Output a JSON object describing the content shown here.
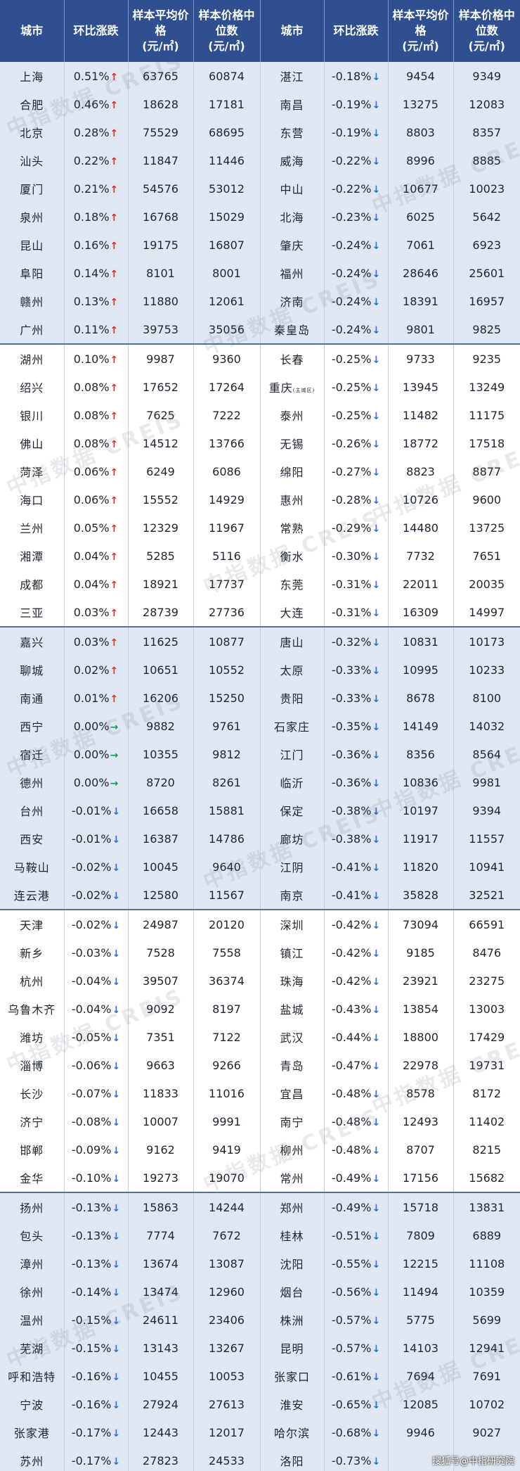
{
  "headers": [
    "城市",
    "环比涨跌",
    "样本平均价格",
    "(元/㎡)",
    "样本价格中位数",
    "(元/㎡)"
  ],
  "rows": [
    {
      "l": [
        "上海",
        "0.51%",
        "up",
        "63765",
        "60874"
      ],
      "r": [
        "湛江",
        "-0.18%",
        "down",
        "9454",
        "9349"
      ]
    },
    {
      "l": [
        "合肥",
        "0.46%",
        "up",
        "18628",
        "17181"
      ],
      "r": [
        "南昌",
        "-0.19%",
        "down",
        "13275",
        "12083"
      ]
    },
    {
      "l": [
        "北京",
        "0.28%",
        "up",
        "75529",
        "68695"
      ],
      "r": [
        "东营",
        "-0.19%",
        "down",
        "8803",
        "8357"
      ]
    },
    {
      "l": [
        "汕头",
        "0.22%",
        "up",
        "11847",
        "11446"
      ],
      "r": [
        "威海",
        "-0.22%",
        "down",
        "8996",
        "8885"
      ]
    },
    {
      "l": [
        "厦门",
        "0.21%",
        "up",
        "54576",
        "53012"
      ],
      "r": [
        "中山",
        "-0.22%",
        "down",
        "10677",
        "10023"
      ]
    },
    {
      "l": [
        "泉州",
        "0.18%",
        "up",
        "16768",
        "15029"
      ],
      "r": [
        "北海",
        "-0.23%",
        "down",
        "6025",
        "5642"
      ]
    },
    {
      "l": [
        "昆山",
        "0.16%",
        "up",
        "19175",
        "16807"
      ],
      "r": [
        "肇庆",
        "-0.24%",
        "down",
        "7061",
        "6923"
      ]
    },
    {
      "l": [
        "阜阳",
        "0.14%",
        "up",
        "8101",
        "8001"
      ],
      "r": [
        "福州",
        "-0.24%",
        "down",
        "28646",
        "25601"
      ]
    },
    {
      "l": [
        "赣州",
        "0.13%",
        "up",
        "11880",
        "12061"
      ],
      "r": [
        "济南",
        "-0.24%",
        "down",
        "18391",
        "16957"
      ]
    },
    {
      "l": [
        "广州",
        "0.11%",
        "up",
        "39753",
        "35056"
      ],
      "r": [
        "秦皇岛",
        "-0.24%",
        "down",
        "9801",
        "9825"
      ]
    },
    {
      "l": [
        "湖州",
        "0.10%",
        "up",
        "9987",
        "9360"
      ],
      "r": [
        "长春",
        "-0.25%",
        "down",
        "9733",
        "9235"
      ]
    },
    {
      "l": [
        "绍兴",
        "0.08%",
        "up",
        "17652",
        "17264"
      ],
      "r": [
        "重庆",
        "-0.25%",
        "down",
        "13945",
        "13249"
      ],
      "r_sub": "(主城区)"
    },
    {
      "l": [
        "银川",
        "0.08%",
        "up",
        "7625",
        "7222"
      ],
      "r": [
        "泰州",
        "-0.25%",
        "down",
        "11482",
        "11175"
      ]
    },
    {
      "l": [
        "佛山",
        "0.08%",
        "up",
        "14512",
        "13766"
      ],
      "r": [
        "无锡",
        "-0.26%",
        "down",
        "18772",
        "17518"
      ]
    },
    {
      "l": [
        "菏泽",
        "0.06%",
        "up",
        "6249",
        "6086"
      ],
      "r": [
        "绵阳",
        "-0.27%",
        "down",
        "8823",
        "8877"
      ]
    },
    {
      "l": [
        "海口",
        "0.06%",
        "up",
        "15552",
        "14929"
      ],
      "r": [
        "惠州",
        "-0.28%",
        "down",
        "10726",
        "9600"
      ]
    },
    {
      "l": [
        "兰州",
        "0.05%",
        "up",
        "12329",
        "11967"
      ],
      "r": [
        "常熟",
        "-0.29%",
        "down",
        "14480",
        "13725"
      ]
    },
    {
      "l": [
        "湘潭",
        "0.04%",
        "up",
        "5285",
        "5116"
      ],
      "r": [
        "衡水",
        "-0.30%",
        "down",
        "7732",
        "7651"
      ]
    },
    {
      "l": [
        "成都",
        "0.04%",
        "up",
        "18921",
        "17737"
      ],
      "r": [
        "东莞",
        "-0.31%",
        "down",
        "22011",
        "20035"
      ]
    },
    {
      "l": [
        "三亚",
        "0.03%",
        "up",
        "28739",
        "27736"
      ],
      "r": [
        "大连",
        "-0.31%",
        "down",
        "16309",
        "14997"
      ]
    },
    {
      "l": [
        "嘉兴",
        "0.03%",
        "up",
        "11625",
        "10877"
      ],
      "r": [
        "唐山",
        "-0.32%",
        "down",
        "10831",
        "10173"
      ]
    },
    {
      "l": [
        "聊城",
        "0.02%",
        "up",
        "10651",
        "10552"
      ],
      "r": [
        "太原",
        "-0.33%",
        "down",
        "10995",
        "10233"
      ]
    },
    {
      "l": [
        "南通",
        "0.01%",
        "up",
        "16206",
        "15250"
      ],
      "r": [
        "贵阳",
        "-0.33%",
        "down",
        "8678",
        "8100"
      ]
    },
    {
      "l": [
        "西宁",
        "0.00%",
        "flat",
        "9882",
        "9761"
      ],
      "r": [
        "石家庄",
        "-0.35%",
        "down",
        "14149",
        "14032"
      ]
    },
    {
      "l": [
        "宿迁",
        "0.00%",
        "flat",
        "10355",
        "9812"
      ],
      "r": [
        "江门",
        "-0.36%",
        "down",
        "8356",
        "8564"
      ]
    },
    {
      "l": [
        "德州",
        "0.00%",
        "flat",
        "8720",
        "8261"
      ],
      "r": [
        "临沂",
        "-0.36%",
        "down",
        "10836",
        "9981"
      ]
    },
    {
      "l": [
        "台州",
        "-0.01%",
        "down",
        "16658",
        "15881"
      ],
      "r": [
        "保定",
        "-0.38%",
        "down",
        "10197",
        "9394"
      ]
    },
    {
      "l": [
        "西安",
        "-0.01%",
        "down",
        "16387",
        "14786"
      ],
      "r": [
        "廊坊",
        "-0.38%",
        "down",
        "11917",
        "11557"
      ]
    },
    {
      "l": [
        "马鞍山",
        "-0.02%",
        "down",
        "10045",
        "9640"
      ],
      "r": [
        "江阴",
        "-0.41%",
        "down",
        "11820",
        "10941"
      ]
    },
    {
      "l": [
        "连云港",
        "-0.02%",
        "down",
        "12580",
        "11567"
      ],
      "r": [
        "南京",
        "-0.41%",
        "down",
        "35828",
        "32521"
      ]
    },
    {
      "l": [
        "天津",
        "-0.02%",
        "down",
        "24987",
        "20120"
      ],
      "r": [
        "深圳",
        "-0.42%",
        "down",
        "73094",
        "66591"
      ]
    },
    {
      "l": [
        "新乡",
        "-0.03%",
        "down",
        "7528",
        "7558"
      ],
      "r": [
        "镇江",
        "-0.42%",
        "down",
        "9185",
        "8476"
      ]
    },
    {
      "l": [
        "杭州",
        "-0.04%",
        "down",
        "39507",
        "36374"
      ],
      "r": [
        "珠海",
        "-0.42%",
        "down",
        "23921",
        "23275"
      ]
    },
    {
      "l": [
        "乌鲁木齐",
        "-0.04%",
        "down",
        "9092",
        "8197"
      ],
      "r": [
        "盐城",
        "-0.43%",
        "down",
        "13854",
        "13003"
      ]
    },
    {
      "l": [
        "潍坊",
        "-0.05%",
        "down",
        "7351",
        "7122"
      ],
      "r": [
        "武汉",
        "-0.44%",
        "down",
        "18800",
        "17429"
      ]
    },
    {
      "l": [
        "淄博",
        "-0.06%",
        "down",
        "9663",
        "9266"
      ],
      "r": [
        "青岛",
        "-0.47%",
        "down",
        "22978",
        "19731"
      ]
    },
    {
      "l": [
        "长沙",
        "-0.07%",
        "down",
        "11833",
        "11016"
      ],
      "r": [
        "宜昌",
        "-0.48%",
        "down",
        "8578",
        "8172"
      ]
    },
    {
      "l": [
        "济宁",
        "-0.08%",
        "down",
        "10007",
        "9991"
      ],
      "r": [
        "南宁",
        "-0.48%",
        "down",
        "12493",
        "11402"
      ]
    },
    {
      "l": [
        "邯郸",
        "-0.09%",
        "down",
        "9162",
        "9419"
      ],
      "r": [
        "柳州",
        "-0.48%",
        "down",
        "8707",
        "8215"
      ]
    },
    {
      "l": [
        "金华",
        "-0.10%",
        "down",
        "19273",
        "19070"
      ],
      "r": [
        "常州",
        "-0.49%",
        "down",
        "17156",
        "15682"
      ]
    },
    {
      "l": [
        "扬州",
        "-0.13%",
        "down",
        "15863",
        "14244"
      ],
      "r": [
        "郑州",
        "-0.49%",
        "down",
        "15718",
        "13831"
      ]
    },
    {
      "l": [
        "包头",
        "-0.13%",
        "down",
        "7774",
        "7672"
      ],
      "r": [
        "桂林",
        "-0.51%",
        "down",
        "7809",
        "6889"
      ]
    },
    {
      "l": [
        "漳州",
        "-0.13%",
        "down",
        "13674",
        "13087"
      ],
      "r": [
        "沈阳",
        "-0.55%",
        "down",
        "12215",
        "11108"
      ]
    },
    {
      "l": [
        "徐州",
        "-0.14%",
        "down",
        "13474",
        "12960"
      ],
      "r": [
        "烟台",
        "-0.56%",
        "down",
        "11494",
        "10359"
      ]
    },
    {
      "l": [
        "温州",
        "-0.15%",
        "down",
        "24611",
        "23406"
      ],
      "r": [
        "株洲",
        "-0.57%",
        "down",
        "5775",
        "5699"
      ]
    },
    {
      "l": [
        "芜湖",
        "-0.15%",
        "down",
        "13143",
        "13267"
      ],
      "r": [
        "昆明",
        "-0.57%",
        "down",
        "14103",
        "12941"
      ]
    },
    {
      "l": [
        "呼和浩特",
        "-0.16%",
        "down",
        "10455",
        "10053"
      ],
      "r": [
        "张家口",
        "-0.61%",
        "down",
        "7694",
        "7691"
      ]
    },
    {
      "l": [
        "宁波",
        "-0.16%",
        "down",
        "27924",
        "27613"
      ],
      "r": [
        "淮安",
        "-0.65%",
        "down",
        "12085",
        "10702"
      ]
    },
    {
      "l": [
        "张家港",
        "-0.17%",
        "down",
        "12443",
        "12017"
      ],
      "r": [
        "哈尔滨",
        "-0.68%",
        "down",
        "9946",
        "9027"
      ]
    },
    {
      "l": [
        "苏州",
        "-0.17%",
        "down",
        "27823",
        "24533"
      ],
      "r": [
        "洛阳",
        "-0.73%",
        "down",
        "",
        ""
      ]
    }
  ],
  "arrows": {
    "up": "↑",
    "down": "↓",
    "flat": "→"
  },
  "colors": {
    "header": "#2f4f91",
    "stripe": "#dfe7f3",
    "up": "#e0302a",
    "down": "#2f6fd3",
    "flat": "#1a9b4a"
  },
  "watermark": "中指数据 CREIS",
  "footer": "搜狐号@中指研究院"
}
